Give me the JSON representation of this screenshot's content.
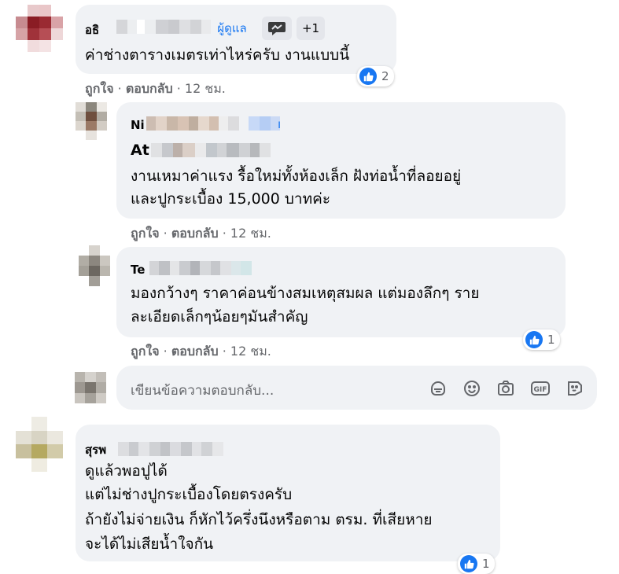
{
  "comments": [
    {
      "author_visible": "อธิ",
      "badge_admin": "ผู้ดูแล",
      "badge_more": "+1",
      "lines": [
        "ค่าช่างตารางเมตรเท่าไหร่ครับ งานแบบนี้"
      ],
      "like_label": "ถูกใจ",
      "reply_label": "ตอบกลับ",
      "time": "12 ชม.",
      "reaction_count": "2"
    },
    {
      "author_visible": "Ni",
      "mention_visible": "At",
      "lines": [
        "งานเหมาค่าแรง รื้อใหม่ทั้งห้องเล็ก ฝังท่อน้ำที่ลอยอยู่",
        "และปูกระเบื้อง 15,000 บาทค่ะ"
      ],
      "like_label": "ถูกใจ",
      "reply_label": "ตอบกลับ",
      "time": "12 ชม."
    },
    {
      "author_visible": "Te",
      "lines": [
        "มองกว้างๆ ราคาค่อนข้างสมเหตุสมผล แต่มองลึกๆ ราย",
        "ละเอียดเล็กๆน้อยๆมันสำคัญ"
      ],
      "like_label": "ถูกใจ",
      "reply_label": "ตอบกลับ",
      "time": "12 ชม.",
      "reaction_count": "1"
    },
    {
      "author_visible": "สุรพ",
      "lines": [
        "ดูแล้วพอปูได้",
        "แต่ไม่ช่างปูกระเบื้องโดยตรงครับ",
        "ถ้ายังไม่จ่ายเงิน ก็หักไว้ครึ่งนึงหรือตาม ตรม. ที่เสียหาย",
        "จะได้ไม่เสียน้ำใจกัน"
      ],
      "reaction_count": "1"
    }
  ],
  "reply_input": {
    "placeholder": "เขียนข้อความตอบกลับ..."
  },
  "reply_tools": [
    "sticker-icon",
    "emoji-icon",
    "camera-icon",
    "gif-icon",
    "sticker-alt-icon"
  ],
  "colors": {
    "bubble": "#f0f2f5",
    "meta_text": "#65676b",
    "like_blue": "#1877f2",
    "text": "#050505"
  }
}
